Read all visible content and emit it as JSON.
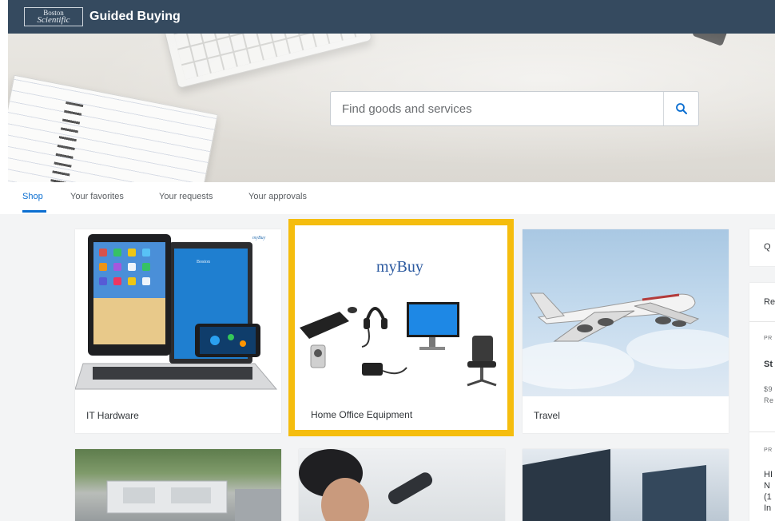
{
  "header": {
    "logo_line1": "Boston",
    "logo_line2": "Scientific",
    "title": "Guided Buying",
    "bg_color": "#354a5f"
  },
  "search": {
    "placeholder": "Find goods and services",
    "icon": "search-icon"
  },
  "tabs": [
    {
      "label": "Shop",
      "active": true
    },
    {
      "label": "Your favorites",
      "active": false
    },
    {
      "label": "Your requests",
      "active": false
    },
    {
      "label": "Your approvals",
      "active": false
    }
  ],
  "tiles": [
    {
      "label": "IT Hardware",
      "badge": "myBuy"
    },
    {
      "label": "Home Office Equipment",
      "brand": "myBuy",
      "highlighted": true
    },
    {
      "label": "Travel"
    }
  ],
  "side_panel": {
    "card1_text": "Q",
    "card2_text": "Re",
    "item1": {
      "tag": "PR",
      "title": "St",
      "line1": "$9",
      "line2": "Re"
    },
    "item2": {
      "tag": "PR",
      "line1": "HI",
      "line2": "N",
      "line3": "(1",
      "line4": "In"
    }
  },
  "colors": {
    "accent": "#0a6ed1",
    "highlight_border": "#f5bd0e"
  }
}
